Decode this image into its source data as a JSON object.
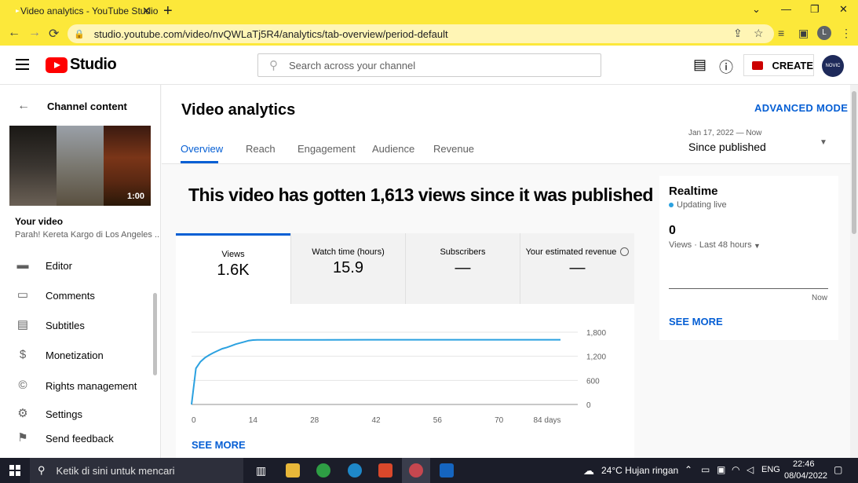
{
  "browser": {
    "tab_title": "Video analytics - YouTube Studio",
    "tab_close": "✕",
    "new_tab": "+",
    "url": "studio.youtube.com/video/nvQWLaTj5R4/analytics/tab-overview/period-default",
    "profile_initial": "L",
    "window_controls": [
      "⌄",
      "—",
      "❐",
      "✕"
    ]
  },
  "studio": {
    "logo_text": "Studio",
    "search_placeholder": "Search across your channel",
    "create_label": "CREATE",
    "avatar_text": "NOVIC"
  },
  "sidebar": {
    "back_label": "Channel content",
    "video_duration": "1:00",
    "your_video_label": "Your video",
    "video_title": "Parah! Kereta Kargo di Los Angeles ...",
    "items": [
      {
        "label": "Editor",
        "icon": "editor-icon"
      },
      {
        "label": "Comments",
        "icon": "comments-icon"
      },
      {
        "label": "Subtitles",
        "icon": "subtitles-icon"
      },
      {
        "label": "Monetization",
        "icon": "dollar-icon"
      },
      {
        "label": "Rights management",
        "icon": "rights-icon"
      },
      {
        "label": "Settings",
        "icon": "gear-icon"
      },
      {
        "label": "Send feedback",
        "icon": "feedback-icon"
      }
    ]
  },
  "main": {
    "title": "Video analytics",
    "advanced_mode": "ADVANCED MODE",
    "tabs": [
      "Overview",
      "Reach",
      "Engagement",
      "Audience",
      "Revenue"
    ],
    "active_tab": "Overview",
    "period_range": "Jan 17, 2022 — Now",
    "period_label": "Since published",
    "headline": "This video has gotten 1,613 views since it was published",
    "metrics": [
      {
        "label": "Views",
        "value": "1.6K"
      },
      {
        "label": "Watch time (hours)",
        "value": "15.9"
      },
      {
        "label": "Subscribers",
        "value": "—"
      },
      {
        "label": "Your estimated revenue",
        "value": "—"
      }
    ],
    "see_more": "SEE MORE"
  },
  "chart_data": {
    "type": "line",
    "series": [
      {
        "x": [
          0,
          1,
          2,
          3,
          4,
          5,
          6,
          7,
          8,
          9,
          10,
          11,
          12,
          13,
          14,
          15,
          20,
          25,
          30,
          40,
          50,
          60,
          70,
          80,
          84
        ],
        "values": [
          0,
          900,
          1060,
          1160,
          1230,
          1290,
          1340,
          1390,
          1420,
          1460,
          1500,
          1530,
          1560,
          1590,
          1605,
          1610,
          1611,
          1611,
          1611,
          1612,
          1612,
          1612,
          1613,
          1613,
          1613
        ]
      }
    ],
    "x_ticks": [
      "0",
      "14",
      "28",
      "42",
      "56",
      "70",
      "84 days"
    ],
    "y_ticks": [
      "1,800",
      "1,200",
      "600",
      "0"
    ],
    "xlim": [
      0,
      84
    ],
    "ylim": [
      0,
      1800
    ],
    "line_color": "#2ba1e0",
    "grid": true
  },
  "realtime": {
    "title": "Realtime",
    "status": "Updating live",
    "count": "0",
    "sub_label": "Views · Last 48 hours",
    "now_label": "Now",
    "see_more": "SEE MORE"
  },
  "taskbar": {
    "search_placeholder": "Ketik di sini untuk mencari",
    "weather": "24°C Hujan ringan",
    "lang": "ENG",
    "time": "22:46",
    "date": "08/04/2022"
  }
}
